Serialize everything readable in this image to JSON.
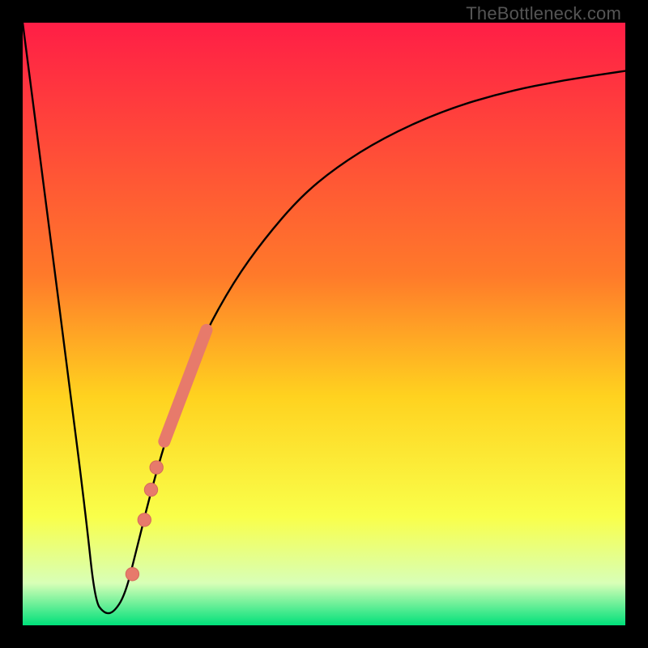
{
  "watermark": "TheBottleneck.com",
  "colors": {
    "gradient_top": "#ff1e46",
    "gradient_mid1": "#ff7a2a",
    "gradient_mid2": "#ffd21f",
    "gradient_mid3": "#f9ff4a",
    "gradient_mid4": "#d8ffb7",
    "gradient_bottom": "#00e07a",
    "curve": "#000000",
    "marker_fill": "#e77a6b",
    "marker_stroke": "#d46a5c"
  },
  "chart_data": {
    "type": "line",
    "title": "",
    "xlabel": "",
    "ylabel": "",
    "xlim": [
      0,
      100
    ],
    "ylim": [
      0,
      100
    ],
    "grid": false,
    "legend": false,
    "series": [
      {
        "name": "bottleneck-curve",
        "x": [
          0,
          4,
          8,
          10.5,
          12,
          13.5,
          15,
          17,
          19,
          22,
          26,
          30,
          35,
          40,
          46,
          52,
          60,
          70,
          80,
          90,
          100
        ],
        "y": [
          100,
          69,
          38,
          18,
          4,
          2,
          2,
          5,
          13,
          25,
          38,
          48,
          57,
          64,
          71,
          76,
          81,
          85.5,
          88.5,
          90.5,
          92
        ]
      }
    ],
    "markers": {
      "name": "highlighted-points",
      "style": "circle",
      "points": [
        {
          "x": 18.2,
          "y": 8.5,
          "r": 1.1
        },
        {
          "x": 20.2,
          "y": 17.5,
          "r": 1.1
        },
        {
          "x": 21.3,
          "y": 22.5,
          "r": 1.1
        },
        {
          "x": 22.2,
          "y": 26.2,
          "r": 1.1
        }
      ],
      "thick_segment": {
        "x_start": 23.5,
        "y_start": 30.5,
        "x_end": 30.5,
        "y_end": 49.0
      }
    }
  }
}
